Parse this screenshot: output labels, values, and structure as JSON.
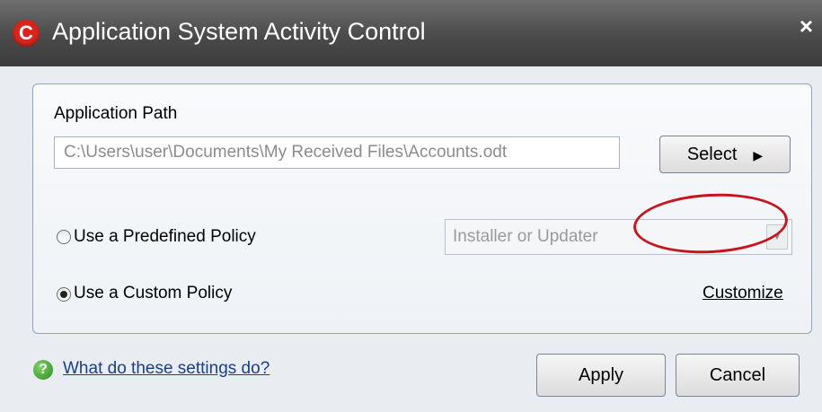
{
  "window": {
    "title": "Application System Activity Control",
    "logo_letter": "C",
    "close_glyph": "×"
  },
  "application_path": {
    "label": "Application Path",
    "value": "C:\\Users\\user\\Documents\\My Received Files\\Accounts.odt",
    "select_button_label": "Select",
    "select_button_arrow": "▶"
  },
  "policy": {
    "predefined_label": "Use a Predefined Policy",
    "predefined_selected": false,
    "predefined_dropdown_value": "Installer or Updater",
    "dropdown_arrow": "▼",
    "custom_label": "Use a Custom Policy",
    "custom_selected": true,
    "customize_link": "Customize"
  },
  "footer": {
    "help_icon": "?",
    "help_link": "What do these settings do?",
    "apply_label": "Apply",
    "cancel_label": "Cancel"
  },
  "colors": {
    "titlebar": "#4a4a4a",
    "logo": "#d9241b",
    "highlight_circle": "#c8141d",
    "help_icon": "#2c8a1a"
  }
}
